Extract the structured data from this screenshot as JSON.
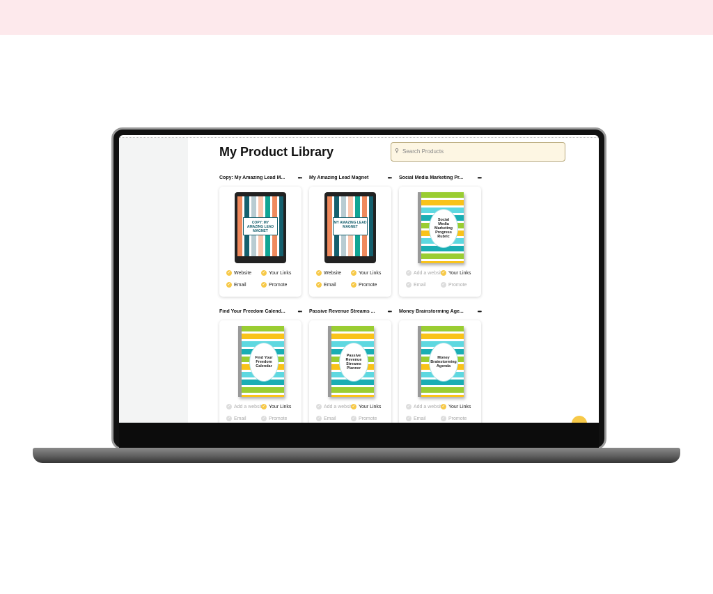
{
  "page": {
    "title": "My Product Library",
    "search": {
      "placeholder": "Search Products",
      "icon": "search-icon"
    }
  },
  "colors": {
    "accent": "#f7c948",
    "inactive": "#dddddd",
    "band": "#fde9ec"
  },
  "products": [
    {
      "title": "Copy: My Amazing Lead M...",
      "cover_text": "COPY: MY AMAZING LEAD MAGNET",
      "cover_type": "tablet",
      "status": [
        {
          "label": "Website",
          "done": true
        },
        {
          "label": "Your Links",
          "done": true
        },
        {
          "label": "Email",
          "done": true
        },
        {
          "label": "Promote",
          "done": true
        }
      ]
    },
    {
      "title": "My Amazing Lead Magnet",
      "cover_text": "MY AMAZING LEAD MAGNET",
      "cover_type": "tablet",
      "status": [
        {
          "label": "Website",
          "done": true
        },
        {
          "label": "Your Links",
          "done": true
        },
        {
          "label": "Email",
          "done": true
        },
        {
          "label": "Promote",
          "done": true
        }
      ]
    },
    {
      "title": "Social Media Marketing Pr...",
      "cover_text": "Social Media Marketing Progress Rubric",
      "cover_type": "book",
      "status": [
        {
          "label": "Add a website",
          "done": false
        },
        {
          "label": "Your Links",
          "done": true
        },
        {
          "label": "Email",
          "done": false
        },
        {
          "label": "Promote",
          "done": false
        }
      ]
    },
    {
      "title": "Find Your Freedom Calend...",
      "cover_text": "Find Your Freedom Calendar",
      "cover_type": "book",
      "status": [
        {
          "label": "Add a website",
          "done": false
        },
        {
          "label": "Your Links",
          "done": true
        },
        {
          "label": "Email",
          "done": false
        },
        {
          "label": "Promote",
          "done": false
        }
      ]
    },
    {
      "title": "Passive Revenue Streams ...",
      "cover_text": "Passive Revenue Streams Planner",
      "cover_type": "book",
      "status": [
        {
          "label": "Add a website",
          "done": false
        },
        {
          "label": "Your Links",
          "done": true
        },
        {
          "label": "Email",
          "done": false
        },
        {
          "label": "Promote",
          "done": false
        }
      ]
    },
    {
      "title": "Money Brainstorming Age...",
      "cover_text": "Money Brainstorming Agenda",
      "cover_type": "book",
      "status": [
        {
          "label": "Add a website",
          "done": false
        },
        {
          "label": "Your Links",
          "done": true
        },
        {
          "label": "Email",
          "done": false
        },
        {
          "label": "Promote",
          "done": false
        }
      ]
    }
  ],
  "more_label": "•••"
}
